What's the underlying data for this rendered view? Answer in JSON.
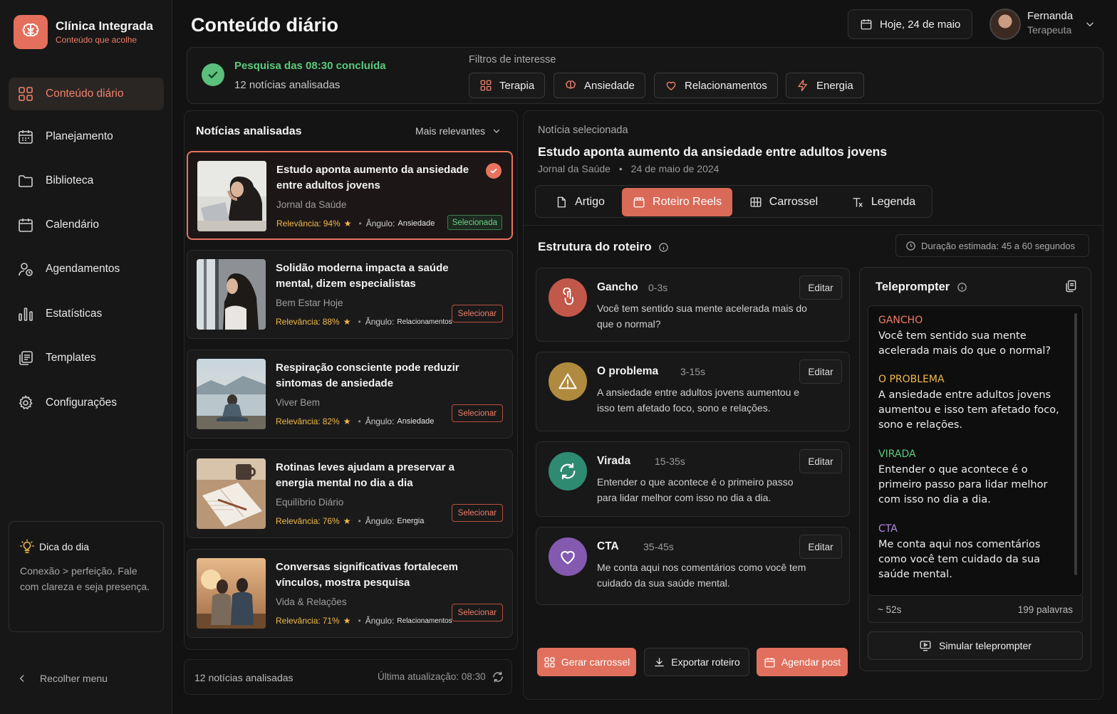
{
  "brand": {
    "name": "Clínica Integrada",
    "tagline": "Conteúdo que acolhe",
    "accent": "#e46f5c"
  },
  "nav": [
    {
      "label": "Conteúdo diário",
      "icon": "grid-icon",
      "active": true
    },
    {
      "label": "Planejamento",
      "icon": "calendar-grid-icon"
    },
    {
      "label": "Biblioteca",
      "icon": "folder-icon"
    },
    {
      "label": "Calendário",
      "icon": "calendar-icon"
    },
    {
      "label": "Agendamentos",
      "icon": "user-clock-icon"
    },
    {
      "label": "Estatísticas",
      "icon": "bar-chart-icon"
    },
    {
      "label": "Templates",
      "icon": "templates-icon"
    },
    {
      "label": "Configurações",
      "icon": "gear-icon"
    }
  ],
  "tip": {
    "title": "Dica do dia",
    "text": "Conexão > perfeição. Fale com clareza e seja presença."
  },
  "collapse_label": "Recolher menu",
  "header": {
    "title": "Conteúdo diário",
    "date": "Hoje, 24 de maio",
    "user_name": "Fernanda",
    "user_role": "Terapeuta"
  },
  "status": {
    "main": "Pesquisa das 08:30 concluída",
    "sub": "12 notícias analisadas",
    "filters_label": "Filtros de interesse",
    "filters": [
      "Terapia",
      "Ansiedade",
      "Relacionamentos",
      "Energia"
    ]
  },
  "news": {
    "title": "Notícias analisadas",
    "sort": "Mais relevantes",
    "relevance_label": "Relevância:",
    "angle_label": "Ângulo:",
    "select_label": "Selecionar",
    "selected_label": "Selecionada",
    "items": [
      {
        "title": "Estudo aponta aumento da ansiedade entre adultos jovens",
        "source": "Jornal da Saúde",
        "relevance": "94%",
        "angle": "Ansiedade",
        "selected": true
      },
      {
        "title": "Solidão moderna impacta a saúde mental, dizem especialistas",
        "source": "Bem Estar Hoje",
        "relevance": "88%",
        "angle": "Relacionamentos",
        "selected": false
      },
      {
        "title": "Respiração consciente pode reduzir sintomas de ansiedade",
        "source": "Viver Bem",
        "relevance": "82%",
        "angle": "Ansiedade",
        "selected": false
      },
      {
        "title": "Rotinas leves ajudam a preservar a energia mental no dia a dia",
        "source": "Equilíbrio Diário",
        "relevance": "76%",
        "angle": "Energia",
        "selected": false
      },
      {
        "title": "Conversas significativas fortalecem vínculos, mostra pesquisa",
        "source": "Vida & Relações",
        "relevance": "71%",
        "angle": "Relacionamentos",
        "selected": false
      }
    ],
    "footer_count": "12 notícias analisadas",
    "footer_update": "Última atualização: 08:30"
  },
  "detail": {
    "label": "Notícia selecionada",
    "title": "Estudo aponta aumento da ansiedade entre adultos jovens",
    "source": "Jornal da Saúde",
    "date": "24 de maio de 2024",
    "tabs": [
      "Artigo",
      "Roteiro Reels",
      "Carrossel",
      "Legenda"
    ],
    "active_tab": "Roteiro Reels",
    "structure_title": "Estrutura do roteiro",
    "duration": "Duração estimada: 45 a 60 segundos",
    "edit_label": "Editar",
    "steps": [
      {
        "name": "Gancho",
        "time": "0-3s",
        "text": "Você tem sentido sua mente acelerada mais do que o normal?",
        "color": "#c2584a"
      },
      {
        "name": "O problema",
        "time": "3-15s",
        "text": "A ansiedade entre adultos jovens aumentou e isso tem afetado foco, sono e relações.",
        "color": "#b08a3e"
      },
      {
        "name": "Virada",
        "time": "15-35s",
        "text": "Entender o que acontece é o primeiro passo para lidar melhor com isso no dia a dia.",
        "color": "#2f8a72"
      },
      {
        "name": "CTA",
        "time": "35-45s",
        "text": "Me conta aqui nos comentários como você tem cuidado da sua saúde mental.",
        "color": "#8459b0"
      }
    ],
    "actions": {
      "carousel": "Gerar carrossel",
      "export": "Exportar roteiro",
      "schedule": "Agendar post"
    }
  },
  "teleprompter": {
    "title": "Teleprompter",
    "sections": [
      {
        "head": "GANCHO",
        "body": "Você tem sentido sua mente acelerada mais do que o normal?",
        "color": "#f07d68"
      },
      {
        "head": "O PROBLEMA",
        "body": "A ansiedade entre adultos jovens aumentou e isso tem afetado foco, sono e relações.",
        "color": "#f2b94a"
      },
      {
        "head": "VIRADA",
        "body": "Entender o que acontece é o primeiro passo para lidar melhor com isso no dia a dia.",
        "color": "#5cc97c"
      },
      {
        "head": "CTA",
        "body": "Me conta aqui nos comentários como você tem cuidado da sua saúde mental.",
        "color": "#b48ae8"
      }
    ],
    "duration": "~ 52s",
    "words": "199 palavras",
    "simulate": "Simular teleprompter"
  }
}
